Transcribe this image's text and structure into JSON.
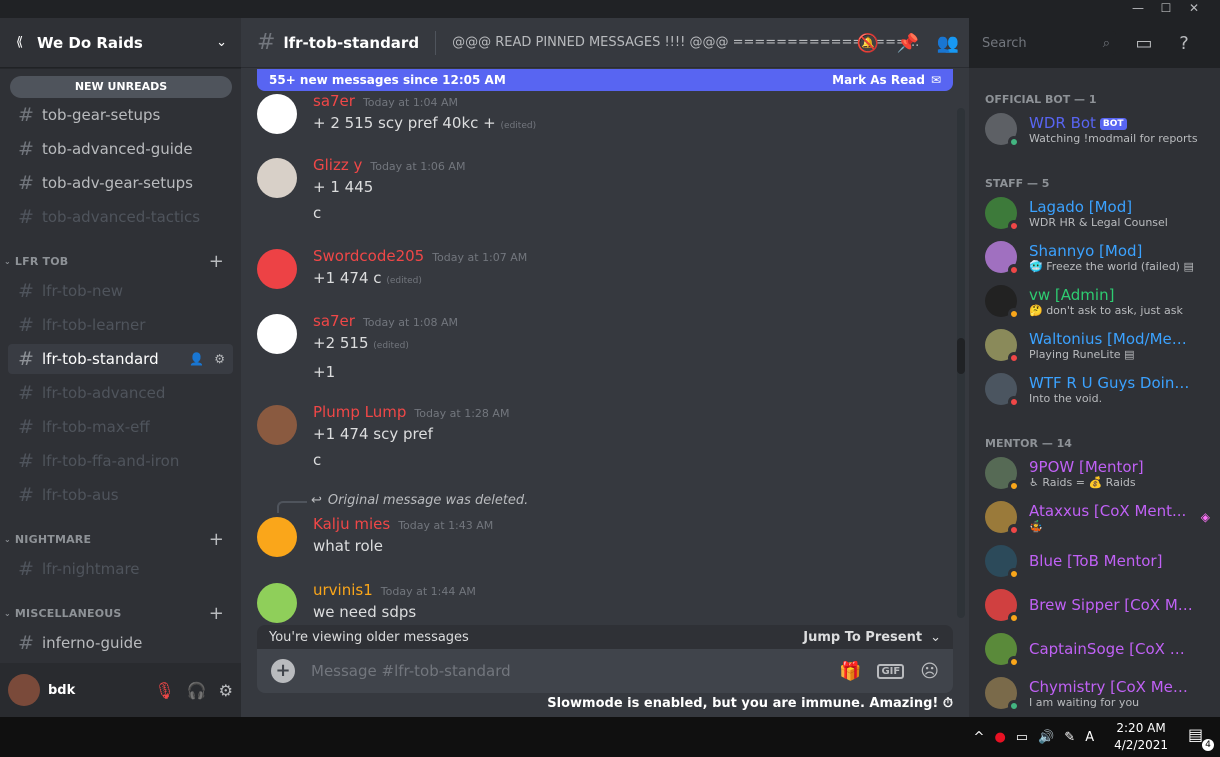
{
  "window": {
    "minimize": "—",
    "maximize": "☐",
    "close": "✕"
  },
  "guild": {
    "name": "We Do Raids",
    "new_unreads": "NEW UNREADS"
  },
  "channels_top": [
    {
      "name": "tob-gear-setups"
    },
    {
      "name": "tob-advanced-guide"
    },
    {
      "name": "tob-adv-gear-setups"
    },
    {
      "name": "tob-advanced-tactics"
    }
  ],
  "categories": {
    "lfr_tob": "LFR TOB",
    "nightmare": "NIGHTMARE",
    "misc": "MISCELLANEOUS"
  },
  "lfr_channels": [
    {
      "name": "lfr-tob-new"
    },
    {
      "name": "lfr-tob-learner"
    },
    {
      "name": "lfr-tob-standard"
    },
    {
      "name": "lfr-tob-advanced"
    },
    {
      "name": "lfr-tob-max-eff"
    },
    {
      "name": "lfr-tob-ffa-and-iron"
    },
    {
      "name": "lfr-tob-aus"
    }
  ],
  "nightmare_channels": [
    {
      "name": "lfr-nightmare"
    }
  ],
  "misc_channels": [
    {
      "name": "inferno-guide"
    }
  ],
  "user": {
    "name": "bdk"
  },
  "chat": {
    "channel": "lfr-tob-standard",
    "topic": "@@@ READ PINNED MESSAGES !!!! @@@ ================...",
    "search_placeholder": "Search",
    "new_messages": "55+ new messages since 12:05 AM",
    "mark_as_read": "Mark As Read",
    "older_notice": "You're viewing older messages",
    "jump_present": "Jump To Present",
    "composer_placeholder": "Message #lfr-tob-standard",
    "gif": "GIF",
    "slowmode": "Slowmode is enabled, but you are immune. Amazing!",
    "edited": "(edited)",
    "deleted_ref": "Original message was deleted."
  },
  "messages": [
    {
      "author": "sa7er",
      "color": "#f04747",
      "time": "Today at 1:04 AM",
      "lines": [
        "+ 2 515 scy pref 40kc +"
      ],
      "edited": true
    },
    {
      "author": "Glizz y",
      "color": "#f04747",
      "time": "Today at 1:06 AM",
      "lines": [
        "+ 1 445",
        "c"
      ]
    },
    {
      "author": "Swordcode205",
      "color": "#f04747",
      "time": "Today at 1:07 AM",
      "lines": [
        "+1 474 c"
      ],
      "edited": true
    },
    {
      "author": "sa7er",
      "color": "#f04747",
      "time": "Today at 1:08 AM",
      "lines": [
        "+2 515",
        "+1"
      ],
      "edited": true
    },
    {
      "author": "Plump Lump",
      "color": "#f04747",
      "time": "Today at 1:28 AM",
      "lines": [
        "+1 474 scy pref",
        "c"
      ]
    },
    {
      "author": "Kalju mies",
      "color": "#f04747",
      "time": "Today at 1:43 AM",
      "lines": [
        "what role"
      ]
    },
    {
      "author": "urvinis1",
      "color": "#faa61a",
      "time": "Today at 1:44 AM",
      "lines": [
        "we need sdps"
      ]
    }
  ],
  "members": {
    "groups": {
      "bot": "OFFICIAL BOT — 1",
      "staff": "STAFF — 5",
      "mentor": "MENTOR — 14"
    },
    "bot_tag": "BOT",
    "list": [
      {
        "name": "WDR Bot",
        "status_text": "Watching !modmail for reports",
        "color": "#5865f2",
        "status": "#43b581",
        "avatar": "#5d6065"
      },
      {
        "name": "Lagado [Mod]",
        "status_text": "WDR HR & Legal Counsel",
        "color": "#3ba2ff",
        "status": "#f04747",
        "avatar": "#3d7a3a"
      },
      {
        "name": "Shannyo [Mod]",
        "status_text": "🥶 Freeze the world (failed) ▤",
        "color": "#3ba2ff",
        "status": "#f04747",
        "avatar": "#a070c0"
      },
      {
        "name": "vw [Admin]",
        "status_text": "🤔 don't ask to ask, just ask",
        "color": "#2ecc71",
        "status": "#faa61a",
        "avatar": "#222222"
      },
      {
        "name": "Waltonius [Mod/Men...",
        "status_text": "Playing RuneLite ▤",
        "color": "#3ba2ff",
        "status": "#f04747",
        "avatar": "#8a8a5a"
      },
      {
        "name": "WTF R U Guys Doing?...",
        "status_text": "Into the void.",
        "color": "#3ba2ff",
        "status": "#f04747",
        "avatar": "#4b5560"
      },
      {
        "name": "9POW [Mentor]",
        "status_text": "♿ Raids = 💰 Raids",
        "color": "#c061f5",
        "status": "#faa61a",
        "avatar": "#566a55"
      },
      {
        "name": "Ataxxus [CoX Ment...",
        "status_text": "🤹",
        "color": "#c061f5",
        "status": "#f04747",
        "avatar": "#9a7a3a"
      },
      {
        "name": "Blue [ToB Mentor]",
        "status_text": "",
        "color": "#c061f5",
        "status": "#faa61a",
        "avatar": "#2c4a5a"
      },
      {
        "name": "Brew Sipper [CoX Me...",
        "status_text": "",
        "color": "#c061f5",
        "status": "#faa61a",
        "avatar": "#d04040"
      },
      {
        "name": "CaptainSoge [CoX Me...",
        "status_text": "",
        "color": "#c061f5",
        "status": "#faa61a",
        "avatar": "#5a8a3a"
      },
      {
        "name": "Chymistry [CoX Ment...",
        "status_text": "I am waiting for you",
        "color": "#c061f5",
        "status": "#43b581",
        "avatar": "#7a6a4a"
      }
    ]
  },
  "taskbar": {
    "time": "2:20 AM",
    "date": "4/2/2021",
    "notif_count": "4"
  }
}
